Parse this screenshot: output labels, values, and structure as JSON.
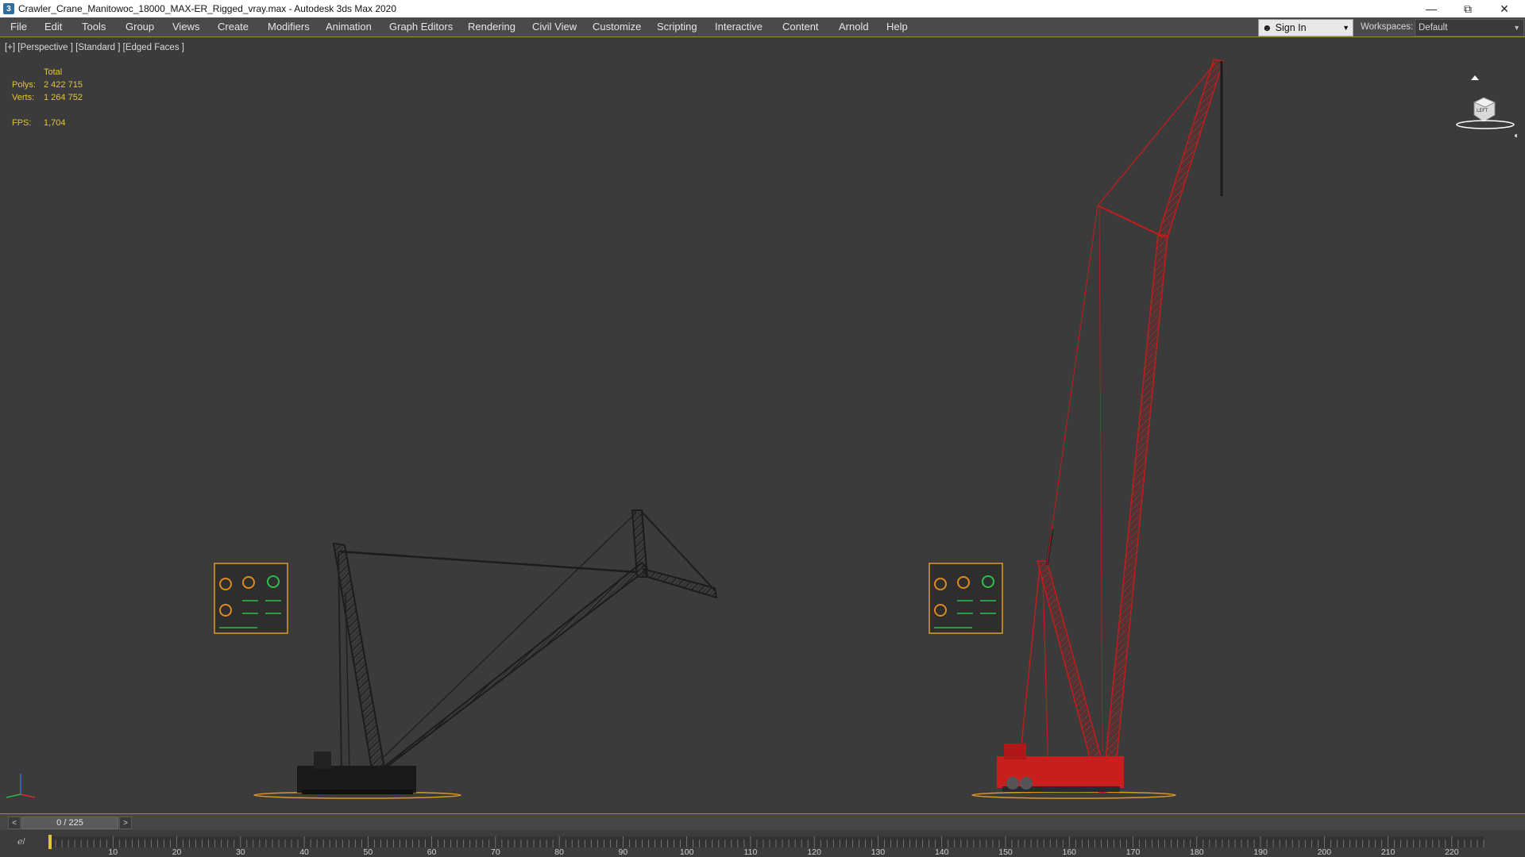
{
  "window": {
    "icon": "3ds-max-app-icon",
    "title": "Crawler_Crane_Manitowoc_18000_MAX-ER_Rigged_vray.max - Autodesk 3ds Max 2020",
    "controls": [
      "minimize-icon",
      "restore-icon",
      "close-icon"
    ]
  },
  "menu": {
    "items": [
      "File",
      "Edit",
      "Tools",
      "Group",
      "Views",
      "Create",
      "Modifiers",
      "Animation",
      "Graph Editors",
      "Rendering",
      "Civil View",
      "Customize",
      "Scripting",
      "Interactive",
      "Content",
      "Arnold",
      "Help"
    ],
    "sign_in": "Sign In",
    "workspaces_label": "Workspaces:",
    "workspace_value": "Default"
  },
  "viewport": {
    "label": "[+] [Perspective ] [Standard ] [Edged Faces ]",
    "stats": {
      "total_label": "Total",
      "polys_label": "Polys:",
      "polys_value": "2 422 715",
      "verts_label": "Verts:",
      "verts_value": "1 264 752",
      "fps_label": "FPS:",
      "fps_value": "1,704"
    },
    "viewcube_face": "LEFT",
    "colors": {
      "background": "#3b3b3b",
      "crane_dark": "#1e1e1e",
      "crane_red": "#d42020",
      "ground_orange": "#d99a2b",
      "stats_yellow": "#e5c43b"
    }
  },
  "timeline": {
    "slider_label": "0 / 225",
    "prev_label": "<",
    "next_label": ">",
    "current_frame": 0,
    "total_frames": 225,
    "tick_labels": [
      "10",
      "20",
      "30",
      "40",
      "50",
      "60",
      "70",
      "80",
      "90",
      "100",
      "110",
      "120",
      "130",
      "140",
      "150",
      "160",
      "170",
      "180",
      "190",
      "200",
      "210",
      "220"
    ]
  }
}
